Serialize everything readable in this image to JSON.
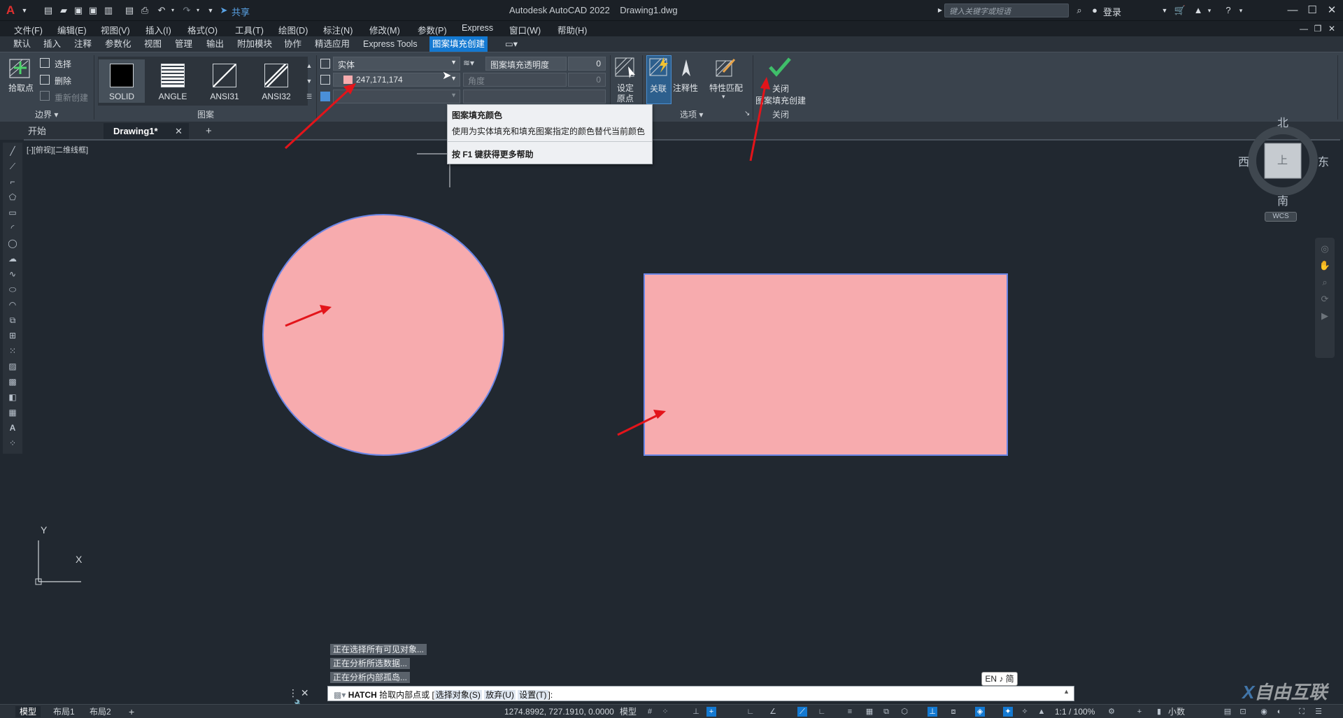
{
  "title_bar": {
    "app_title": "Autodesk AutoCAD 2022",
    "file_name": "Drawing1.dwg",
    "share_label": "共享",
    "search_placeholder": "键入关键字或短语",
    "login_label": "登录"
  },
  "menu": [
    "文件(F)",
    "编辑(E)",
    "视图(V)",
    "插入(I)",
    "格式(O)",
    "工具(T)",
    "绘图(D)",
    "标注(N)",
    "修改(M)",
    "参数(P)",
    "Express",
    "窗口(W)",
    "帮助(H)"
  ],
  "ribbon_tabs": [
    "默认",
    "插入",
    "注释",
    "参数化",
    "视图",
    "管理",
    "输出",
    "附加模块",
    "协作",
    "精选应用",
    "Express Tools",
    "图案填充创建"
  ],
  "active_ribbon_tab": "图案填充创建",
  "ribbon": {
    "boundary": {
      "pick_points_label": "拾取点",
      "select_label": "选择",
      "remove_label": "删除",
      "recreate_label": "重新创建",
      "panel_title": "边界"
    },
    "pattern": {
      "items": [
        "SOLID",
        "ANGLE",
        "ANSI31",
        "ANSI32"
      ],
      "panel_title": "图案"
    },
    "properties": {
      "hatch_type": "实体",
      "hatch_color": "247,171,174",
      "hatch_color_hex": "#f7abae",
      "transparency_label": "图案填充透明度",
      "transparency_value": "0",
      "angle_label": "角度",
      "angle_value": "0"
    },
    "origin": {
      "set_origin_label_1": "设定",
      "set_origin_label_2": "原点"
    },
    "options": {
      "associative_label": "关联",
      "annotative_label": "注释性",
      "match_props_label": "特性匹配",
      "panel_title": "选项"
    },
    "close": {
      "label_1": "关闭",
      "label_2": "图案填充创建",
      "panel_title": "关闭"
    }
  },
  "tooltip": {
    "title": "图案填充颜色",
    "description": "使用为实体填充和填充图案指定的颜色替代当前颜色",
    "help": "按 F1 键获得更多帮助"
  },
  "doc_tabs": {
    "start": "开始",
    "drawing": "Drawing1*"
  },
  "viewport_label": "[-][俯视][二维线框]",
  "viewcube": {
    "north": "北",
    "south": "南",
    "east": "东",
    "west": "西",
    "top_face": "上",
    "wcs": "WCS"
  },
  "ucs": {
    "x": "X",
    "y": "Y"
  },
  "progress_messages": [
    "正在选择所有可见对象...",
    "正在分析所选数据...",
    "正在分析内部孤岛..."
  ],
  "command_line": {
    "command": "HATCH",
    "prompt": "拾取内部点或",
    "option_1": "选择对象(S)",
    "option_2": "放弃(U)",
    "option_3": "设置(T)",
    "suffix": "]:"
  },
  "ime_indicator": "EN ♪ 简",
  "status_bar": {
    "layout_tabs": [
      "模型",
      "布局1",
      "布局2"
    ],
    "coordinates": "1274.8992, 727.1910, 0.0000",
    "model_label": "模型",
    "scale": "1:1 / 100%",
    "units": "小数"
  },
  "watermark": "自由互联",
  "colors": {
    "accent": "#1479d1",
    "arrow": "#e3141a",
    "fill": "#f7abae",
    "boundary": "#6a86e6",
    "confirm": "#3fbf6a"
  }
}
